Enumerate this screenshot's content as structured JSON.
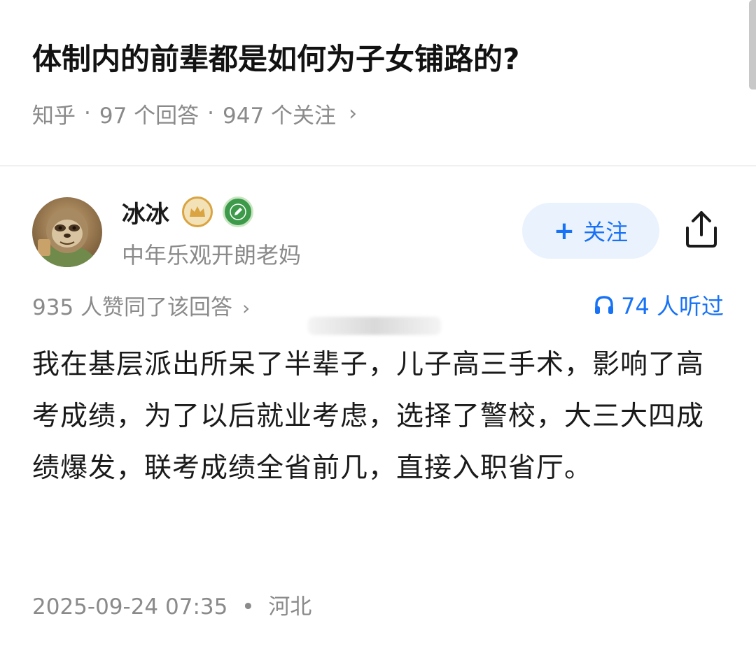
{
  "question": {
    "title": "体制内的前辈都是如何为子女铺路的?",
    "source": "知乎",
    "answers": "97 个回答",
    "followers": "947 个关注",
    "separator": "·",
    "chevron": "›"
  },
  "author": {
    "name": "冰冰",
    "bio": "中年乐观开朗老妈",
    "follow_label": "关注",
    "follow_plus": "+"
  },
  "stats": {
    "likes": "935 人赞同了该回答",
    "chevron": "›",
    "listens": "74 人听过"
  },
  "answer": {
    "content": "我在基层派出所呆了半辈子，儿子高三手术，影响了高考成绩，为了以后就业考虑，选择了警校，大三大四成绩爆发，联考成绩全省前几，直接入职省厅。",
    "date": "2025-09-24 07:35",
    "separator": "•",
    "location": "河北"
  },
  "colors": {
    "accent": "#1772f6",
    "follow_bg": "#eaf2fd",
    "muted_text": "#8a8a8a",
    "badge_gold": "#d9a441",
    "badge_green": "#3c9a4a"
  },
  "icons": {
    "crown_badge": "crown-badge-icon",
    "pen_badge": "pen-badge-icon",
    "share": "share-icon",
    "headphones": "headphones-icon"
  }
}
